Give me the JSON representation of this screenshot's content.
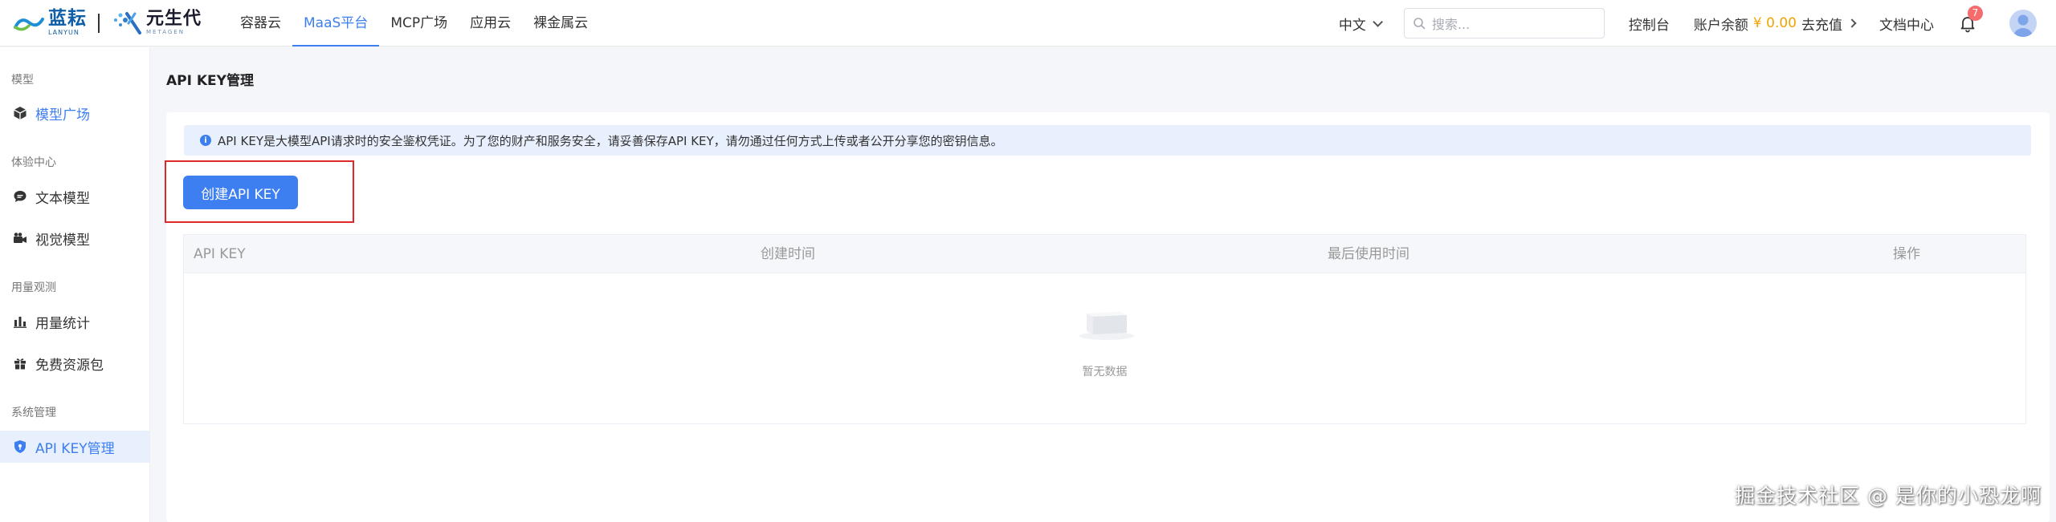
{
  "header": {
    "logo_lanyun_cn": "蓝耘",
    "logo_lanyun_en": "LANYUN",
    "logo_yuan_cn": "元生代",
    "logo_yuan_en": "METAGEN",
    "nav": [
      {
        "label": "容器云",
        "active": false
      },
      {
        "label": "MaaS平台",
        "active": true
      },
      {
        "label": "MCP广场",
        "active": false
      },
      {
        "label": "应用云",
        "active": false
      },
      {
        "label": "裸金属云",
        "active": false
      }
    ],
    "language": "中文",
    "search_placeholder": "搜索...",
    "console": "控制台",
    "balance_label": "账户余额",
    "balance_amount": "¥ 0.00",
    "recharge": "去充值",
    "docs": "文档中心",
    "notification_count": "7"
  },
  "sidebar": {
    "groups": [
      {
        "title": "模型",
        "items": [
          {
            "label": "模型广场",
            "icon": "cube-icon"
          }
        ]
      },
      {
        "title": "体验中心",
        "items": [
          {
            "label": "文本模型",
            "icon": "chat-icon"
          },
          {
            "label": "视觉模型",
            "icon": "camera-icon"
          }
        ]
      },
      {
        "title": "用量观测",
        "items": [
          {
            "label": "用量统计",
            "icon": "bar-chart-icon"
          },
          {
            "label": "免费资源包",
            "icon": "gift-icon"
          }
        ]
      },
      {
        "title": "系统管理",
        "items": [
          {
            "label": "API KEY管理",
            "icon": "shield-icon"
          }
        ]
      }
    ]
  },
  "main": {
    "page_title": "API KEY管理",
    "alert_text": "API KEY是大模型API请求时的安全鉴权凭证。为了您的财产和服务安全，请妥善保存API KEY，请勿通过任何方式上传或者公开分享您的密钥信息。",
    "create_button": "创建API KEY",
    "table": {
      "columns": [
        "API KEY",
        "创建时间",
        "最后使用时间",
        "操作"
      ],
      "rows": [],
      "empty_text": "暂无数据"
    }
  },
  "watermark": "掘金技术社区 @ 是你的小恐龙啊",
  "colors": {
    "accent": "#3d7ef0",
    "balance": "#f5a100",
    "highlight": "#e0272a",
    "badge": "#f56c6c"
  }
}
